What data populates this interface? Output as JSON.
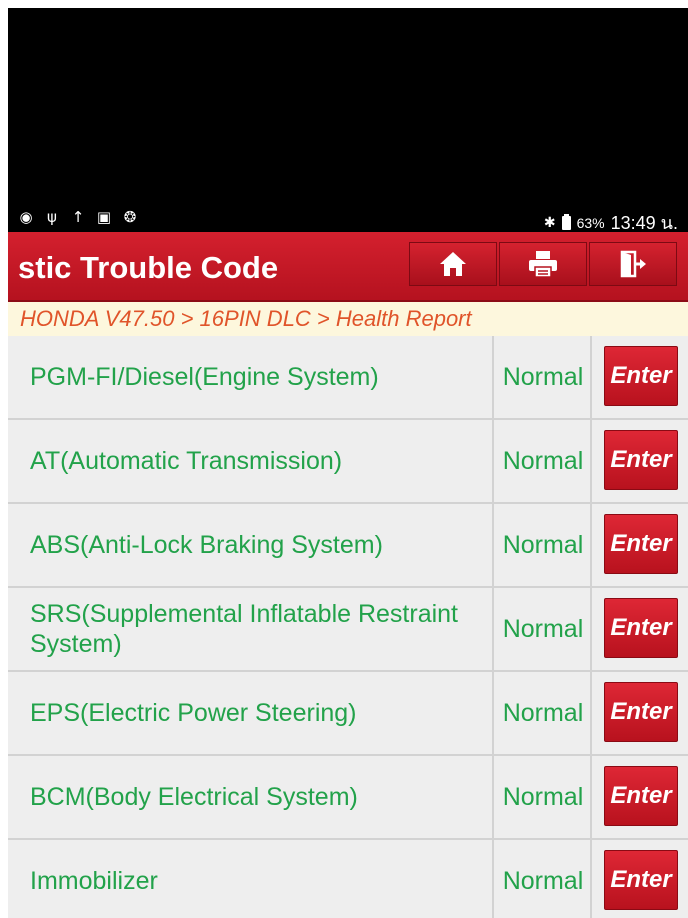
{
  "statusbar": {
    "left_icons": [
      "chat-icon",
      "usb-debug-icon",
      "upload-icon",
      "image-icon",
      "bluetooth-status-icon"
    ],
    "bluetooth_icon": "bluetooth-icon",
    "battery_percent": "63%",
    "time": "13:49 น."
  },
  "header": {
    "title": "stic Trouble Code",
    "buttons": [
      "home-icon",
      "print-icon",
      "exit-icon"
    ]
  },
  "breadcrumb": "HONDA V47.50 > 16PIN DLC > Health Report",
  "systems": [
    {
      "name": "PGM-FI/Diesel(Engine System)",
      "status": "Normal",
      "action": "Enter"
    },
    {
      "name": "AT(Automatic Transmission)",
      "status": "Normal",
      "action": "Enter"
    },
    {
      "name": "ABS(Anti-Lock Braking System)",
      "status": "Normal",
      "action": "Enter"
    },
    {
      "name": "SRS(Supplemental Inflatable Restraint System)",
      "status": "Normal",
      "action": "Enter"
    },
    {
      "name": "EPS(Electric Power Steering)",
      "status": "Normal",
      "action": "Enter"
    },
    {
      "name": "BCM(Body Electrical System)",
      "status": "Normal",
      "action": "Enter"
    },
    {
      "name": "Immobilizer",
      "status": "Normal",
      "action": "Enter"
    }
  ],
  "colors": {
    "header_red": "#c41a27",
    "status_green": "#22a24a",
    "breadcrumb_orange": "#e0542a",
    "breadcrumb_bg": "#fdf7dd"
  }
}
